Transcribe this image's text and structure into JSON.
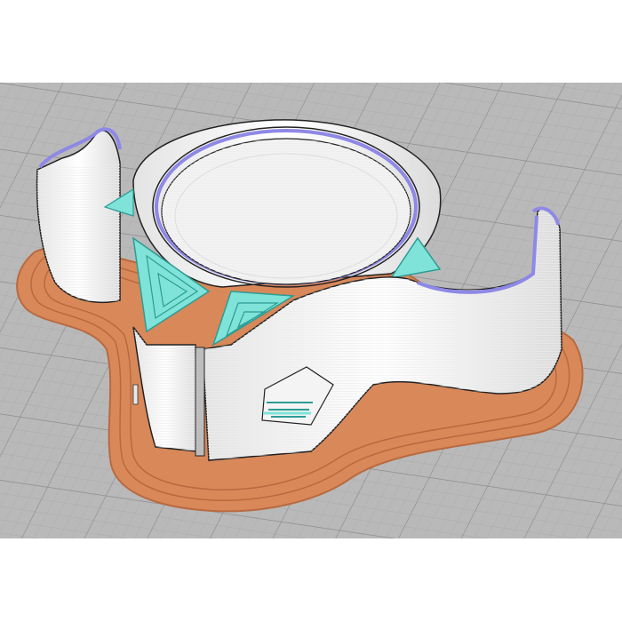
{
  "viewer": {
    "view": "slicer-preview-3d",
    "model": "clamp-hook",
    "colors": {
      "background_top": "#ffffff",
      "build_plate": "#b9b9b9",
      "grid_fine": "#a6a6a6",
      "grid_major": "#8f8f8f",
      "brim": "#d9885a",
      "brim_line": "#b86a3f",
      "outer_wall": "#ffffff",
      "wall_shadow": "#d4d4d4",
      "inner_wall": "#8e88e6",
      "infill": "#7fe3d9",
      "infill_line": "#2c9c94",
      "edge": "#222222"
    }
  }
}
